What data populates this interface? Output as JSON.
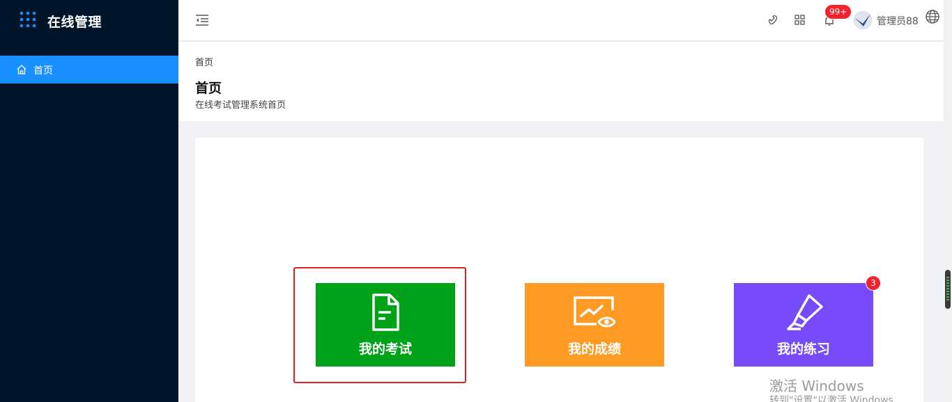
{
  "app": {
    "title": "在线管理"
  },
  "sidebar": {
    "items": [
      {
        "label": "首页",
        "icon": "home-icon",
        "active": true
      }
    ]
  },
  "header": {
    "notification_count": "99+",
    "user_name": "管理员88",
    "icons": [
      "menu-fold-icon",
      "phone-icon",
      "apps-icon",
      "bell-icon",
      "globe-icon"
    ]
  },
  "page": {
    "breadcrumb": "首页",
    "title": "首页",
    "description": "在线考试管理系统首页"
  },
  "tiles": [
    {
      "label": "我的考试",
      "color": "#00a21a",
      "icon": "file-text-icon"
    },
    {
      "label": "我的成绩",
      "color": "#ff9a24",
      "icon": "chart-eye-icon"
    },
    {
      "label": "我的练习",
      "color": "#774bfa",
      "icon": "highlighter-icon",
      "badge": "3"
    }
  ],
  "watermark": {
    "line1": "激活 Windows",
    "line2": "转到\"设置\"以激活 Windows"
  },
  "colors": {
    "sidebar": "#001529",
    "accent": "#1890ff",
    "badge": "#f5222d",
    "selection": "#e02020"
  }
}
